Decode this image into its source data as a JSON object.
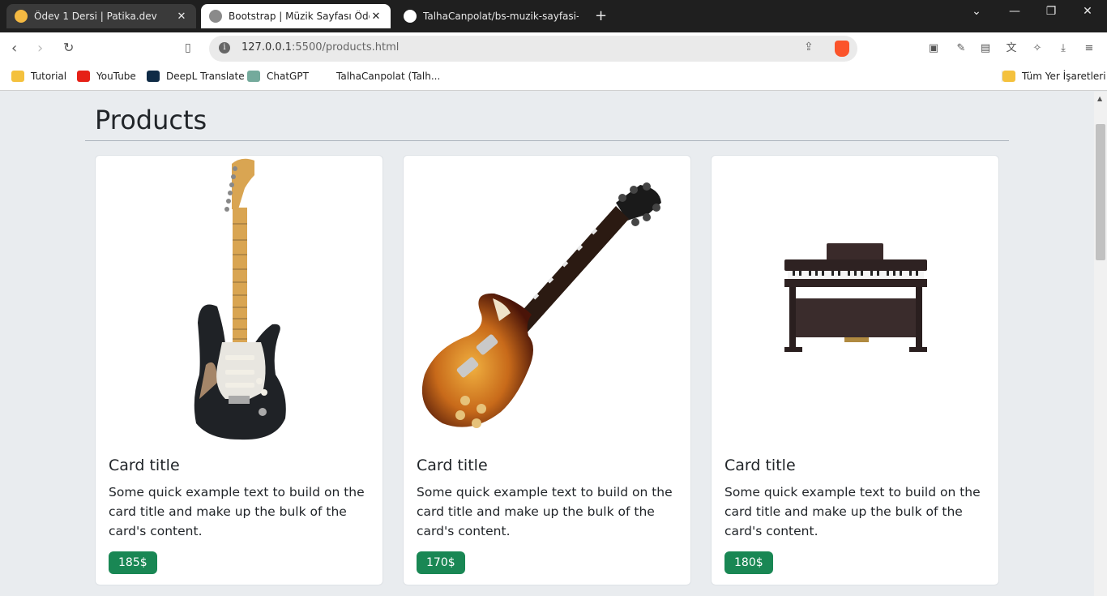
{
  "tabs": [
    {
      "title": "Ödev 1 Dersi | Patika.dev",
      "color": "#f4b942"
    },
    {
      "title": "Bootstrap | Müzik Sayfası Ödev -",
      "color": "#8a8a8a"
    },
    {
      "title": "TalhaCanpolat/bs-muzik-sayfasi-ode",
      "color": "#ffffff"
    }
  ],
  "address": {
    "host": "127.0.0.1",
    "path": ":5500/products.html"
  },
  "bookmarks": [
    {
      "label": "Tutorial",
      "icon": "folder-icon"
    },
    {
      "label": "YouTube",
      "icon": "youtube-icon"
    },
    {
      "label": "DeepL Translate",
      "icon": "deepl-icon"
    },
    {
      "label": "ChatGPT",
      "icon": "chatgpt-icon"
    },
    {
      "label": "TalhaCanpolat (Talh...",
      "icon": "github-icon"
    },
    {
      "label": "Tüm Yer İşaretleri",
      "icon": "folder-icon"
    }
  ],
  "page": {
    "heading": "Products"
  },
  "products": [
    {
      "title": "Card title",
      "text": "Some quick example text to build on the card title and make up the bulk of the card's content.",
      "price": "185$",
      "image": "electric-guitar"
    },
    {
      "title": "Card title",
      "text": "Some quick example text to build on the card title and make up the bulk of the card's content.",
      "price": "170$",
      "image": "les-paul-guitar"
    },
    {
      "title": "Card title",
      "text": "Some quick example text to build on the card title and make up the bulk of the card's content.",
      "price": "180$",
      "image": "digital-piano"
    }
  ],
  "colors": {
    "price_badge": "#198754",
    "page_bg": "#e9ecef"
  }
}
